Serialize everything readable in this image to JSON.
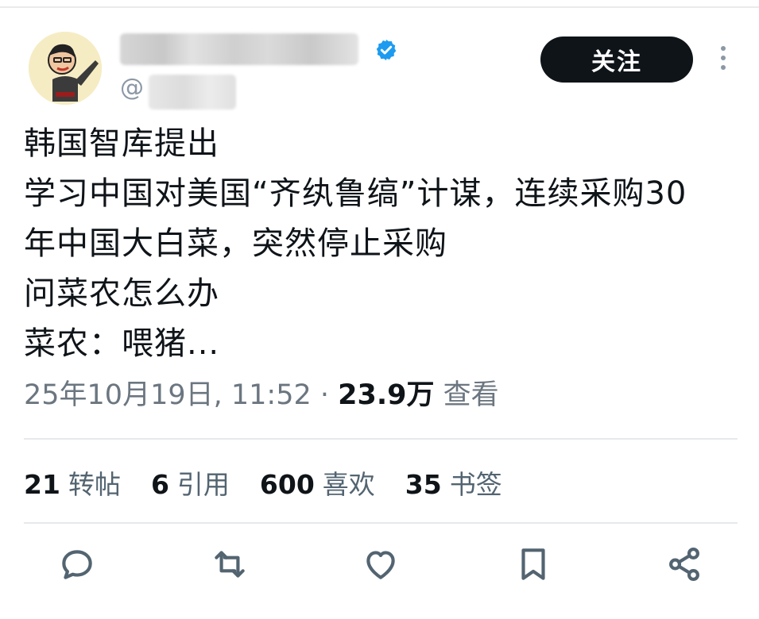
{
  "header": {
    "handle_prefix": "@",
    "follow_label": "关注"
  },
  "tweet": {
    "lines": [
      "韩国智库提出",
      "学习中国对美国“齐纨鲁缟”计谋，连续采购30",
      "年中国大白菜，突然停止采购",
      "问菜农怎么办",
      "菜农：喂猪..."
    ],
    "timestamp": "25年10月19日, 11:52",
    "separator": " · ",
    "views_count": "23.9万",
    "views_label": "查看"
  },
  "stats": [
    {
      "num": "21",
      "label": "转帖"
    },
    {
      "num": "6",
      "label": "引用"
    },
    {
      "num": "600",
      "label": "喜欢"
    },
    {
      "num": "35",
      "label": "书签"
    }
  ],
  "actions": [
    {
      "icon": "reply-icon"
    },
    {
      "icon": "retweet-icon"
    },
    {
      "icon": "like-icon"
    },
    {
      "icon": "bookmark-icon"
    },
    {
      "icon": "share-icon"
    }
  ],
  "colors": {
    "text": "#0f1419",
    "secondary": "#536471",
    "verified": "#1d9bf0",
    "button_bg": "#0f1419"
  }
}
